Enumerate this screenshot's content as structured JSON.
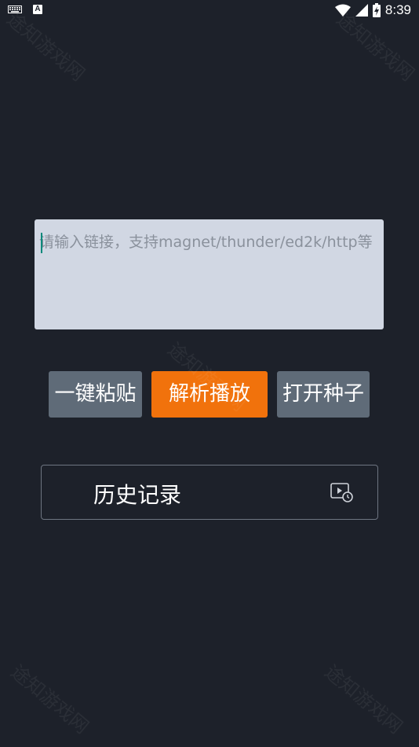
{
  "status_bar": {
    "time": "8:39",
    "keyboard_icon": "keyboard-icon",
    "a_icon_letter": "A",
    "wifi_icon": "wifi-icon",
    "signal_icon": "signal-icon",
    "battery_icon": "battery-charging-icon"
  },
  "link_input": {
    "value": "",
    "placeholder": "请输入链接，支持magnet/thunder/ed2k/http等"
  },
  "buttons": {
    "paste_label": "一键粘贴",
    "parse_label": "解析播放",
    "open_seed_label": "打开种子"
  },
  "history": {
    "label": "历史记录",
    "icon": "video-history-icon"
  },
  "watermark": {
    "text": "途知游戏网"
  },
  "colors": {
    "background": "#1d212a",
    "input_bg": "#d1d7e3",
    "button_gray": "#5f6b78",
    "accent_orange": "#f1720c",
    "caret_teal": "#00897b"
  }
}
